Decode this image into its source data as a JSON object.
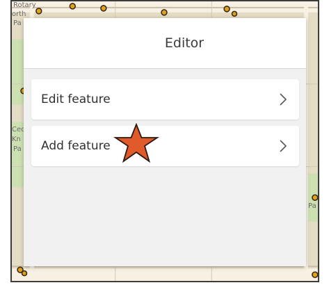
{
  "panel": {
    "title": "Editor",
    "items": [
      {
        "label": "Edit feature",
        "chevron": "chevron-right-icon"
      },
      {
        "label": "Add feature",
        "chevron": "chevron-right-icon"
      }
    ]
  },
  "annotation": {
    "icon": "star-icon",
    "color": "#e05a2b"
  },
  "map": {
    "labels": [
      "Rotary",
      "orth",
      "Pa",
      "Cec",
      "Kn",
      "Pa",
      "Pa"
    ],
    "colors": {
      "base": "#e4dcc4",
      "park": "#cde0b2",
      "road": "#f6f1e3",
      "point": "#e0a020"
    }
  }
}
